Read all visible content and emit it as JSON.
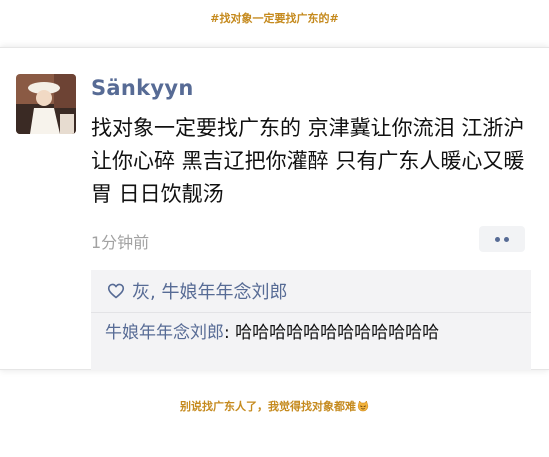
{
  "header": {
    "hashtag": "#找对象一定要找广东的#"
  },
  "post": {
    "username": "Sänkyyn",
    "text": "找对象一定要找广东的 京津冀让你流泪 江浙沪让你心碎 黑吉辽把你灌醉 只有广东人暖心又暖胃 日日饮靓汤",
    "time": "1分钟前",
    "likes": "灰, 牛娘年年念刘郎",
    "comment": {
      "author": "牛娘年年念刘郎",
      "separator": ": ",
      "text": "哈哈哈哈哈哈哈哈哈哈哈哈"
    }
  },
  "footer": {
    "caption": "别说找广东人了，我觉得找对象都难"
  },
  "icons": {
    "heart": "heart-outline-icon",
    "more": "more-dots-icon",
    "emoji": "cat-face-emoji-icon"
  },
  "colors": {
    "link": "#576b95",
    "accent": "#c58a1e",
    "muted": "#a2a2a2"
  }
}
